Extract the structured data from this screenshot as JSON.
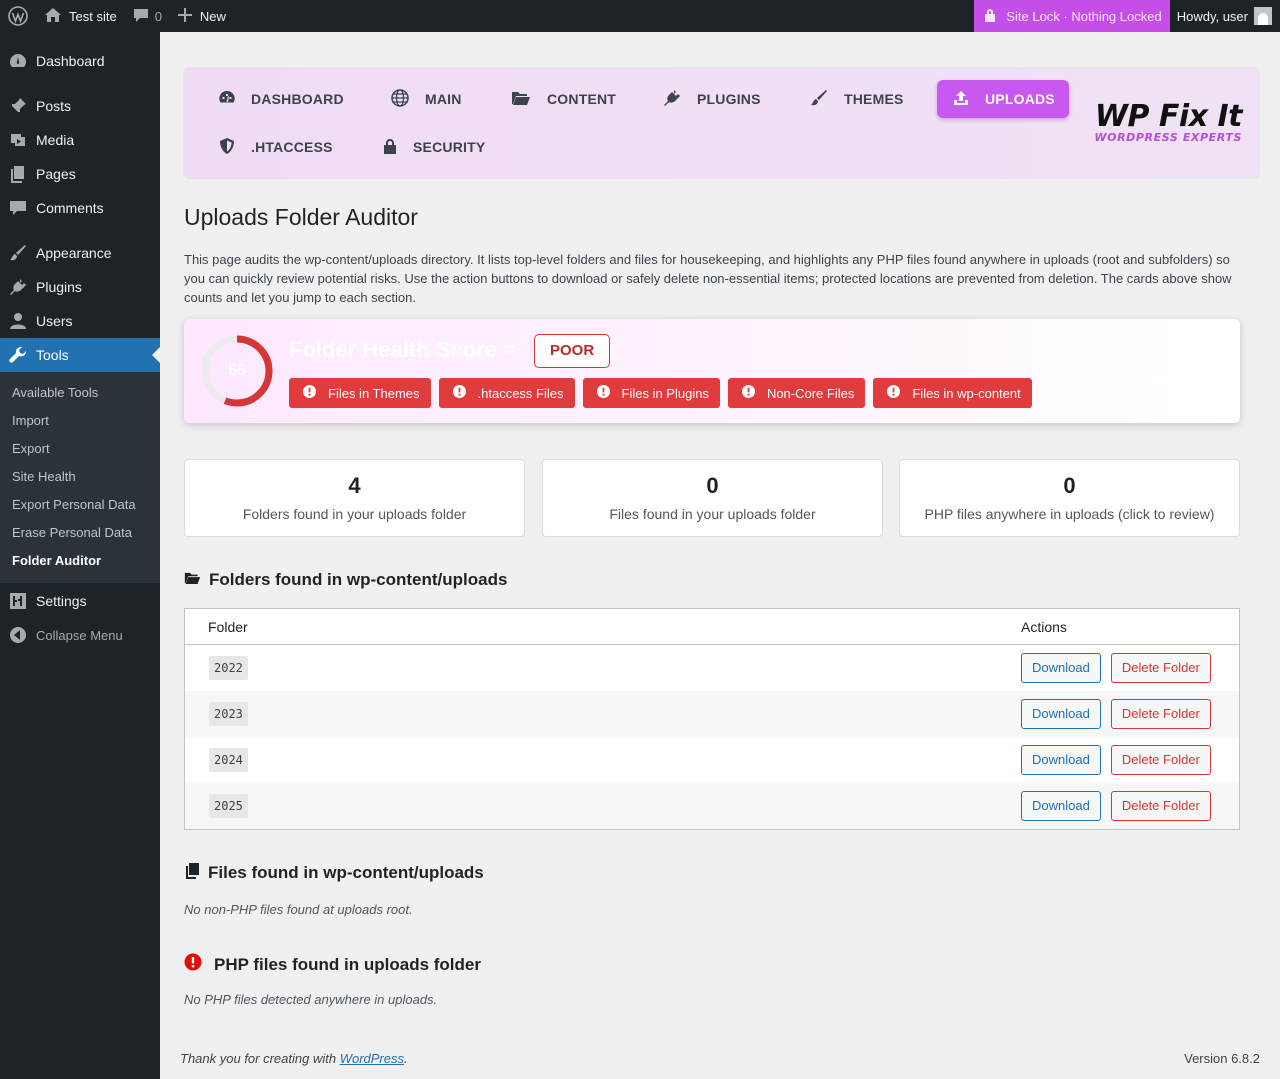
{
  "adminbar": {
    "site_name": "Test site",
    "comments_count": "0",
    "new_label": "New",
    "site_lock": "Site Lock · Nothing Locked",
    "howdy": "Howdy, user"
  },
  "sidebar": {
    "items": [
      {
        "label": "Dashboard"
      },
      {
        "label": "Posts"
      },
      {
        "label": "Media"
      },
      {
        "label": "Pages"
      },
      {
        "label": "Comments"
      },
      {
        "label": "Appearance"
      },
      {
        "label": "Plugins"
      },
      {
        "label": "Users"
      },
      {
        "label": "Tools"
      },
      {
        "label": "Settings"
      },
      {
        "label": "Collapse Menu"
      }
    ],
    "tools_submenu": [
      "Available Tools",
      "Import",
      "Export",
      "Site Health",
      "Export Personal Data",
      "Erase Personal Data",
      "Folder Auditor"
    ]
  },
  "plugin_nav": {
    "tabs": [
      "DASHBOARD",
      "MAIN",
      "CONTENT",
      "PLUGINS",
      "THEMES",
      "UPLOADS",
      ".HTACCESS",
      "SECURITY"
    ],
    "active_tab": "UPLOADS",
    "brand_name": "WP Fix It",
    "brand_tagline": "WORDPRESS EXPERTS",
    "accent_color": "#c759f0"
  },
  "page": {
    "title": "Uploads Folder Auditor",
    "intro": "This page audits the wp-content/uploads directory. It lists top-level folders and files for housekeeping, and highlights any PHP files found anywhere in uploads (root and subfolders) so you can quickly review potential risks. Use the action buttons to download or safely delete non-essential items; protected locations are prevented from deletion. The cards above show counts and let you jump to each section."
  },
  "health": {
    "score": "56",
    "score_value": 56,
    "title": "Folder Health Score =",
    "grade": "POOR",
    "status_color": "#d63638",
    "flags": [
      "Files in Themes",
      ".htaccess Files",
      "Files in Plugins",
      "Non-Core Files",
      "Files in wp-content"
    ]
  },
  "stats": [
    {
      "value": "4",
      "label": "Folders found in your uploads folder"
    },
    {
      "value": "0",
      "label": "Files found in your uploads folder"
    },
    {
      "value": "0",
      "label": "PHP files anywhere in uploads (click to review)"
    }
  ],
  "folders_section": {
    "heading": "Folders found in wp-content/uploads",
    "col_folder": "Folder",
    "col_actions": "Actions",
    "download_label": "Download",
    "delete_label": "Delete Folder",
    "rows": [
      "2022",
      "2023",
      "2024",
      "2025"
    ]
  },
  "files_section": {
    "heading": "Files found in wp-content/uploads",
    "empty": "No non-PHP files found at uploads root."
  },
  "php_section": {
    "heading": "PHP files found in uploads folder",
    "empty": "No PHP files detected anywhere in uploads."
  },
  "footer": {
    "thanks_prefix": "Thank you for creating with",
    "thanks_link": "WordPress",
    "thanks_suffix": ".",
    "version": "Version 6.8.2"
  }
}
